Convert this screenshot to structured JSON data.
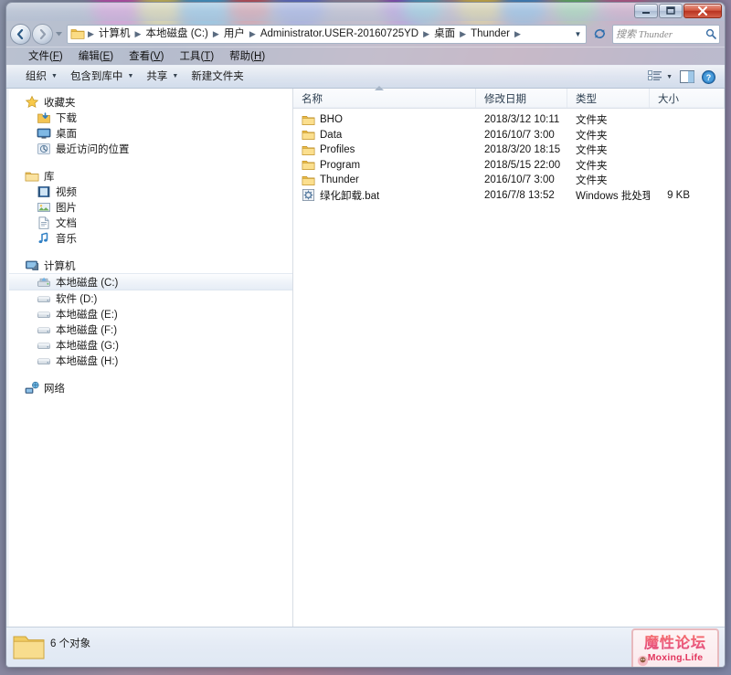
{
  "window": {
    "controls": {
      "minimize": "最小化",
      "maximize": "最大化",
      "close": "关闭"
    }
  },
  "address": {
    "back_label": "后退",
    "forward_label": "前进",
    "history_label": "最近浏览的位置",
    "breadcrumbs": [
      "计算机",
      "本地磁盘 (C:)",
      "用户",
      "Administrator.USER-20160725YD",
      "桌面",
      "Thunder"
    ],
    "dropdown_label": "▼",
    "refresh_label": "刷新",
    "search_placeholder": "搜索 Thunder"
  },
  "menubar": {
    "items": [
      {
        "text": "文件",
        "accel": "F"
      },
      {
        "text": "编辑",
        "accel": "E"
      },
      {
        "text": "查看",
        "accel": "V"
      },
      {
        "text": "工具",
        "accel": "T"
      },
      {
        "text": "帮助",
        "accel": "H"
      }
    ]
  },
  "toolbar": {
    "organize": "组织",
    "include_in_library": "包含到库中",
    "share": "共享",
    "new_folder": "新建文件夹",
    "view_label": "更改您的视图",
    "preview_label": "显示预览窗格",
    "help_label": "获取帮助"
  },
  "navpane": {
    "groups": [
      {
        "header": {
          "label": "收藏夹",
          "icon": "star-icon"
        },
        "items": [
          {
            "label": "下载",
            "icon": "downloads-icon"
          },
          {
            "label": "桌面",
            "icon": "desktop-icon"
          },
          {
            "label": "最近访问的位置",
            "icon": "recent-places-icon"
          }
        ]
      },
      {
        "header": {
          "label": "库",
          "icon": "library-icon"
        },
        "items": [
          {
            "label": "视频",
            "icon": "video-icon"
          },
          {
            "label": "图片",
            "icon": "pictures-icon"
          },
          {
            "label": "文档",
            "icon": "documents-icon"
          },
          {
            "label": "音乐",
            "icon": "music-icon"
          }
        ]
      },
      {
        "header": {
          "label": "计算机",
          "icon": "computer-icon"
        },
        "items": [
          {
            "label": "本地磁盘 (C:)",
            "icon": "system-drive-icon",
            "selected": true
          },
          {
            "label": "软件 (D:)",
            "icon": "drive-icon"
          },
          {
            "label": "本地磁盘 (E:)",
            "icon": "drive-icon"
          },
          {
            "label": "本地磁盘 (F:)",
            "icon": "drive-icon"
          },
          {
            "label": "本地磁盘 (G:)",
            "icon": "drive-icon"
          },
          {
            "label": "本地磁盘 (H:)",
            "icon": "drive-icon"
          }
        ]
      },
      {
        "header": {
          "label": "网络",
          "icon": "network-icon"
        },
        "items": []
      }
    ]
  },
  "filepane": {
    "columns": [
      {
        "key": "name",
        "label": "名称",
        "sorted": true
      },
      {
        "key": "date",
        "label": "修改日期"
      },
      {
        "key": "type",
        "label": "类型"
      },
      {
        "key": "size",
        "label": "大小"
      }
    ],
    "rows": [
      {
        "name": "BHO",
        "date": "2018/3/12 10:11",
        "type": "文件夹",
        "size": "",
        "icon": "folder-icon"
      },
      {
        "name": "Data",
        "date": "2016/10/7 3:00",
        "type": "文件夹",
        "size": "",
        "icon": "folder-icon"
      },
      {
        "name": "Profiles",
        "date": "2018/3/20 18:15",
        "type": "文件夹",
        "size": "",
        "icon": "folder-icon"
      },
      {
        "name": "Program",
        "date": "2018/5/15 22:00",
        "type": "文件夹",
        "size": "",
        "icon": "folder-icon"
      },
      {
        "name": "Thunder",
        "date": "2016/10/7 3:00",
        "type": "文件夹",
        "size": "",
        "icon": "folder-icon"
      },
      {
        "name": "绿化卸载.bat",
        "date": "2016/7/8 13:52",
        "type": "Windows 批处理...",
        "size": "9 KB",
        "icon": "batch-file-icon"
      }
    ]
  },
  "statusbar": {
    "item_count": "6 个对象",
    "icon": "folder-large-icon"
  },
  "watermark": {
    "chinese": "魔性论坛",
    "latin": "Moxing.Life"
  },
  "colors": {
    "accent": "#2e6da4",
    "close_button": "#c0392b",
    "folder": "#f5c75b",
    "selection": "#e6edf6"
  }
}
